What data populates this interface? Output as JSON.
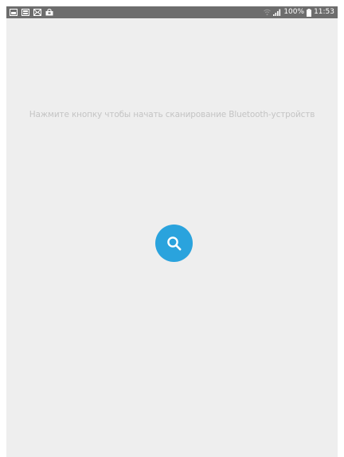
{
  "status_bar": {
    "notification_icons": [
      "image-icon",
      "image-icon",
      "mail-icon",
      "shopping-bag-icon"
    ],
    "battery_percent": "100%",
    "time": "11:53"
  },
  "main": {
    "hint": "Нажмите кнопку чтобы начать сканирование Bluetooth-устройств",
    "scan_button_icon": "search-icon"
  },
  "colors": {
    "status_bar_bg": "#6d6d6d",
    "screen_bg": "#eeeeee",
    "hint_text": "#c4c4c4",
    "scan_button_bg": "#2aa3dd"
  }
}
